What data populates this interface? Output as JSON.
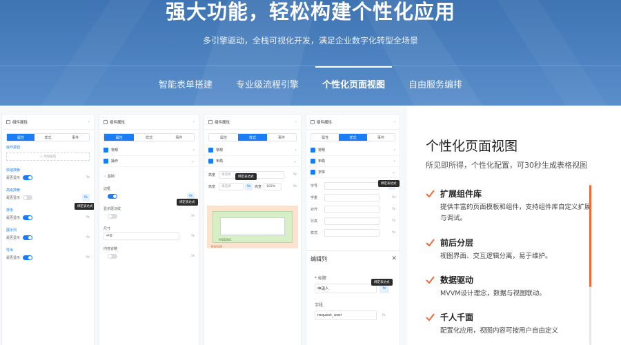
{
  "hero": {
    "title": "强大功能，轻松构建个性化应用",
    "subtitle": "多引擎驱动，全栈可视化开发，满足企业数字化转型全场景",
    "tabs": [
      {
        "label": "智能表单搭建",
        "active": false
      },
      {
        "label": "专业级流程引擎",
        "active": false
      },
      {
        "label": "个性化页面视图",
        "active": true
      },
      {
        "label": "自由服务编排",
        "active": false
      }
    ]
  },
  "mock": {
    "panel_title": "组件属性",
    "tabs": [
      "属性",
      "样式",
      "事件"
    ],
    "tip": "绑定表达式",
    "fx": "fx",
    "p1": {
      "action_button": "操作按钮",
      "add_button": "+ 添加按钮",
      "groups": [
        "快速搜索",
        "高级搜索",
        "排序",
        "展示列",
        "导出"
      ],
      "row_label": "是否显示"
    },
    "p2": {
      "sections": [
        "常规",
        "操作"
      ],
      "adv_section": "基础",
      "fields": [
        "边框",
        "显示斑马纹",
        "尺寸",
        "内容省略"
      ],
      "size_value": "中等"
    },
    "p3": {
      "sections": [
        "常规",
        "布局"
      ],
      "width_label": "高宽",
      "width_value": "请选择",
      "height_label": "高宽",
      "height_value": "请选择",
      "percent": "100%",
      "margin": "MARGIN",
      "padding": "PADDING"
    },
    "p4": {
      "sections": [
        "常规",
        "布局",
        "字体"
      ],
      "font_fields": [
        "字号",
        "字重",
        "对齐",
        "行高",
        "样式"
      ],
      "edit_col": "编辑列",
      "title_label": "* 标题",
      "title_value": "申请人",
      "field_label": "字段",
      "field_value": "request_user"
    }
  },
  "right": {
    "title": "个性化页面视图",
    "subtitle": "所见即所得，个性化配置，可30秒生成表格视图",
    "features": [
      {
        "title": "扩展组件库",
        "desc": "提供丰富的页面模板和组件，支持组件库自定义扩展与调试。"
      },
      {
        "title": "前后分层",
        "desc": "视图界面、交互逻辑分离，易于维护。"
      },
      {
        "title": "数据驱动",
        "desc": "MVVM设计理念，数据与视图联动。"
      },
      {
        "title": "千人千面",
        "desc": "配置化应用，视图内容可按用户自由定义"
      }
    ],
    "accent": "#f06a3a"
  }
}
